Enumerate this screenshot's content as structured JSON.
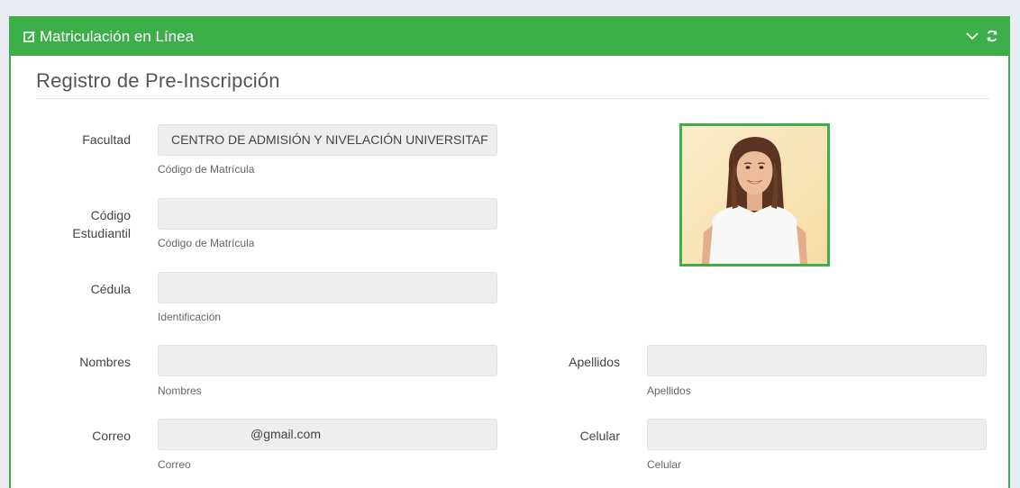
{
  "panel": {
    "title": "Matriculación en Línea",
    "icons": {
      "title_icon": "edit-icon",
      "collapse": "chevron-down-icon",
      "refresh": "refresh-icon"
    },
    "accent_color": "#3dae4a"
  },
  "form": {
    "section_title": "Registro de Pre-Inscripción",
    "facultad": {
      "label": "Facultad",
      "value": "CENTRO DE ADMISIÓN Y NIVELACIÓN UNIVERSITAF",
      "help": "Código de Matrícula"
    },
    "codigo": {
      "label_line1": "Código",
      "label_line2": "Estudiantil",
      "value": "",
      "help": "Código de Matrícula"
    },
    "cedula": {
      "label": "Cédula",
      "value": "",
      "help": "Identificación"
    },
    "nombres": {
      "label": "Nombres",
      "value": "",
      "help": "Nombres"
    },
    "apellidos": {
      "label": "Apellidos",
      "value": "",
      "help": "Apellidos"
    },
    "correo": {
      "label": "Correo",
      "value": "@gmail.com",
      "help": "Correo"
    },
    "celular": {
      "label": "Celular",
      "value": "",
      "help": "Celular"
    }
  },
  "photo": {
    "icon": "student-photo"
  }
}
